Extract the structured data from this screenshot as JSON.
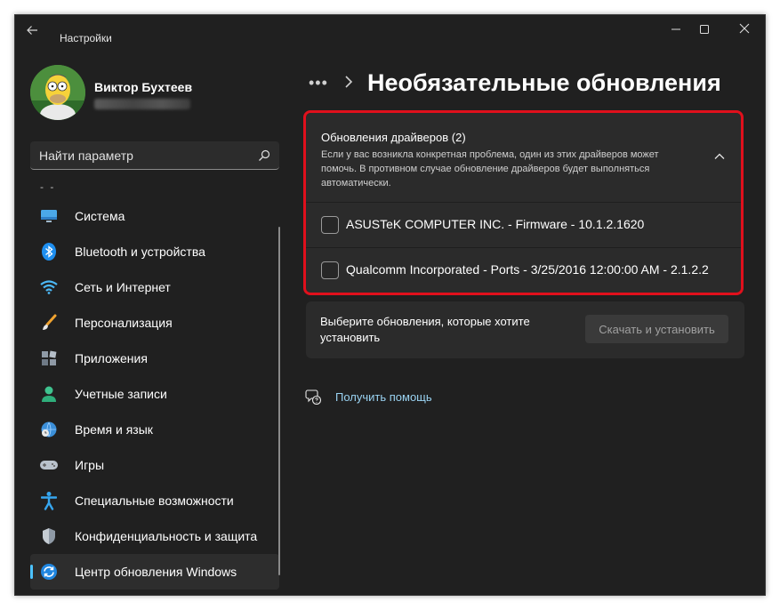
{
  "window": {
    "app_title": "Настройки",
    "back_icon": "arrow-left-icon",
    "controls": [
      "minimize-icon",
      "maximize-icon",
      "close-icon"
    ]
  },
  "profile": {
    "name": "Виктор Бухтеев"
  },
  "search": {
    "placeholder": "Найти параметр",
    "icon": "search-icon"
  },
  "sidebar": {
    "items": [
      {
        "label": "Система",
        "icon": "monitor-icon"
      },
      {
        "label": "Bluetooth и устройства",
        "icon": "bluetooth-icon"
      },
      {
        "label": "Сеть и Интернет",
        "icon": "wifi-icon"
      },
      {
        "label": "Персонализация",
        "icon": "brush-icon"
      },
      {
        "label": "Приложения",
        "icon": "apps-icon"
      },
      {
        "label": "Учетные записи",
        "icon": "person-icon"
      },
      {
        "label": "Время и язык",
        "icon": "globe-clock-icon"
      },
      {
        "label": "Игры",
        "icon": "gamepad-icon"
      },
      {
        "label": "Специальные возможности",
        "icon": "accessibility-icon"
      },
      {
        "label": "Конфиденциальность и защита",
        "icon": "shield-icon"
      },
      {
        "label": "Центр обновления Windows",
        "icon": "windows-update-icon",
        "active": true
      }
    ]
  },
  "main": {
    "breadcrumb_more": "•••",
    "page_title": "Необязательные обновления",
    "driver_section": {
      "title": "Обновления драйверов (2)",
      "description": "Если у вас возникла конкретная проблема, один из этих драйверов может помочь. В противном случае обновление драйверов будет выполняться автоматически.",
      "items": [
        {
          "label": "ASUSTeK COMPUTER INC. - Firmware - 10.1.2.1620",
          "checked": false
        },
        {
          "label": "Qualcomm Incorporated - Ports - 3/25/2016 12:00:00 AM - 2.1.2.2",
          "checked": false
        }
      ]
    },
    "install": {
      "text": "Выберите обновления, которые хотите установить",
      "button_label": "Скачать и установить"
    },
    "help_label": "Получить помощь"
  },
  "colors": {
    "window_bg": "#202020",
    "card_bg": "#2b2b2b",
    "accent": "#4cc2ff",
    "highlight": "#e0101c",
    "link": "#9ad3f2"
  }
}
